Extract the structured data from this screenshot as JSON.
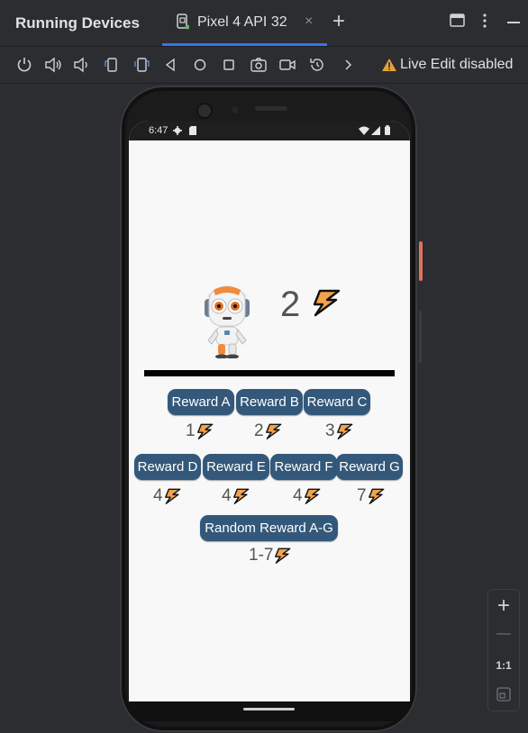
{
  "panel": {
    "title": "Running Devices",
    "tab_label": "Pixel 4 API 32",
    "tab_close": "×",
    "new_tab": "+"
  },
  "toolbar": {
    "icons": [
      "power-icon",
      "volume-up-icon",
      "volume-down-icon",
      "rotate-left-icon",
      "rotate-right-icon",
      "back-icon",
      "home-icon",
      "overview-icon",
      "screenshot-icon",
      "screen-record-icon",
      "reset-icon",
      "more-chevron-icon"
    ],
    "live_edit_text": "Live Edit disabled",
    "accent": "#3574f0",
    "warning_color": "#e5a235"
  },
  "device": {
    "status_time": "6:47"
  },
  "app": {
    "energy": "2",
    "rewards_row1": [
      {
        "label": "Reward A",
        "cost": "1"
      },
      {
        "label": "Reward B",
        "cost": "2"
      },
      {
        "label": "Reward C",
        "cost": "3"
      }
    ],
    "rewards_row2": [
      {
        "label": "Reward D",
        "cost": "4"
      },
      {
        "label": "Reward E",
        "cost": "4"
      },
      {
        "label": "Reward F",
        "cost": "4"
      },
      {
        "label": "Reward G",
        "cost": "7"
      }
    ],
    "random_reward": {
      "label": "Random Reward A-G",
      "cost": "1-7"
    },
    "button_color": "#33587a"
  },
  "zoom": {
    "zoom_in": "+",
    "zoom_out": "—",
    "actual_size": "1:1"
  }
}
